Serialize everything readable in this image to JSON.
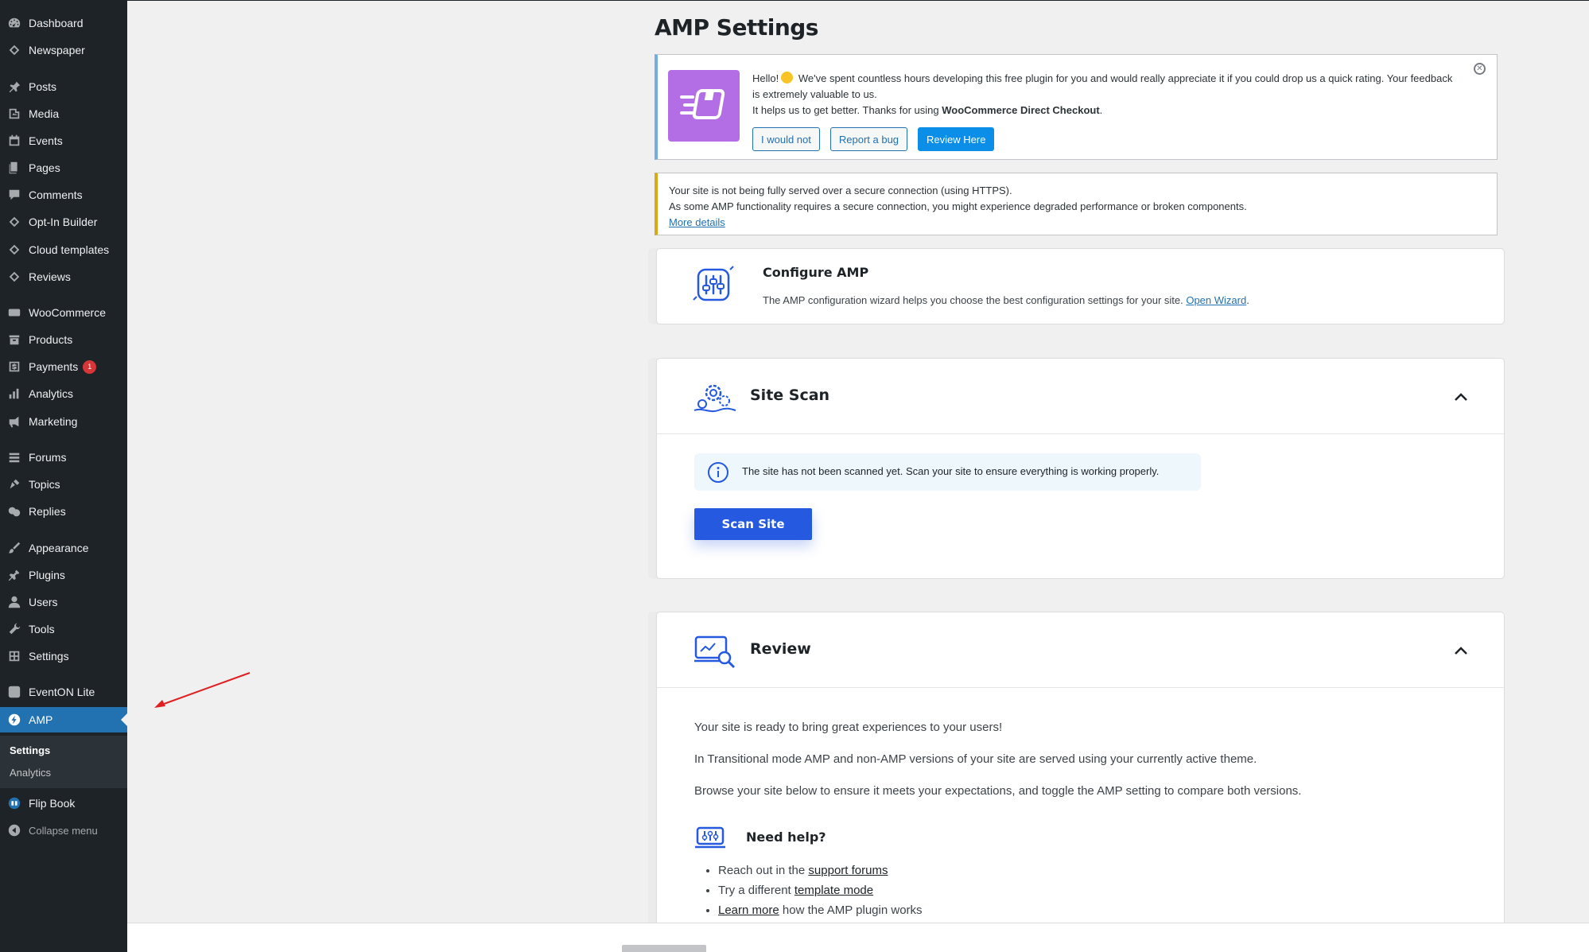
{
  "sidebar": {
    "items": [
      {
        "label": "Dashboard",
        "icon": "dashboard-icon"
      },
      {
        "label": "Newspaper",
        "icon": "newspaper-icon"
      },
      {
        "label": "Posts",
        "icon": "pin-icon"
      },
      {
        "label": "Media",
        "icon": "media-icon"
      },
      {
        "label": "Events",
        "icon": "calendar-icon"
      },
      {
        "label": "Pages",
        "icon": "pages-icon"
      },
      {
        "label": "Comments",
        "icon": "comments-icon"
      },
      {
        "label": "Opt-In Builder",
        "icon": "optin-icon"
      },
      {
        "label": "Cloud templates",
        "icon": "cloud-templates-icon"
      },
      {
        "label": "Reviews",
        "icon": "reviews-icon"
      },
      {
        "label": "WooCommerce",
        "icon": "woocommerce-icon"
      },
      {
        "label": "Products",
        "icon": "products-icon"
      },
      {
        "label": "Payments",
        "icon": "payments-icon",
        "badge": "1"
      },
      {
        "label": "Analytics",
        "icon": "analytics-icon"
      },
      {
        "label": "Marketing",
        "icon": "megaphone-icon"
      },
      {
        "label": "Forums",
        "icon": "forums-icon"
      },
      {
        "label": "Topics",
        "icon": "topics-icon"
      },
      {
        "label": "Replies",
        "icon": "replies-icon"
      },
      {
        "label": "Appearance",
        "icon": "brush-icon"
      },
      {
        "label": "Plugins",
        "icon": "plugin-icon"
      },
      {
        "label": "Users",
        "icon": "user-icon"
      },
      {
        "label": "Tools",
        "icon": "wrench-icon"
      },
      {
        "label": "Settings",
        "icon": "settings-icon"
      },
      {
        "label": "EventON Lite",
        "icon": "eventon-icon"
      },
      {
        "label": "AMP",
        "icon": "amp-icon"
      },
      {
        "label": "Flip Book",
        "icon": "flipbook-icon"
      }
    ],
    "submenu": {
      "settings": "Settings",
      "analytics": "Analytics"
    },
    "collapse": "Collapse menu"
  },
  "page": {
    "title": "AMP Settings"
  },
  "review_notice": {
    "hello": "Hello!",
    "line1": " We've spent countless hours developing this free plugin for you and would really appreciate it if you could drop us a quick rating. Your feedback is extremely valuable to us.",
    "line2_prefix": "It helps us to get better. Thanks for using ",
    "plugin_name": "WooCommerce Direct Checkout",
    "line2_suffix": ".",
    "btn_no": "I would not",
    "btn_bug": "Report a bug",
    "btn_review": "Review Here"
  },
  "https_notice": {
    "line1": "Your site is not being fully served over a secure connection (using HTTPS).",
    "line2": "As some AMP functionality requires a secure connection, you might experience degraded performance or broken components.",
    "link": "More details"
  },
  "configure": {
    "title": "Configure AMP",
    "desc": "The AMP configuration wizard helps you choose the best configuration settings for your site. ",
    "link": "Open Wizard",
    "suffix": "."
  },
  "site_scan": {
    "title": "Site Scan",
    "info": "The site has not been scanned yet. Scan your site to ensure everything is working properly.",
    "button": "Scan Site"
  },
  "review": {
    "title": "Review",
    "p1": "Your site is ready to bring great experiences to your users!",
    "p2": "In Transitional mode AMP and non-AMP versions of your site are served using your currently active theme.",
    "p3": "Browse your site below to ensure it meets your expectations, and toggle the AMP setting to compare both versions.",
    "help_title": "Need help?",
    "help1_prefix": "Reach out in the ",
    "help1_link": "support forums",
    "help2_prefix": "Try a different ",
    "help2_link": "template mode",
    "help3_link": "Learn more",
    "help3_suffix": " how the AMP plugin works"
  },
  "colors": {
    "accent": "#2271b1",
    "sidebar": "#1d2327",
    "scan_button": "#2459e0",
    "promo": "#b36ee6",
    "warning": "#dba617"
  }
}
